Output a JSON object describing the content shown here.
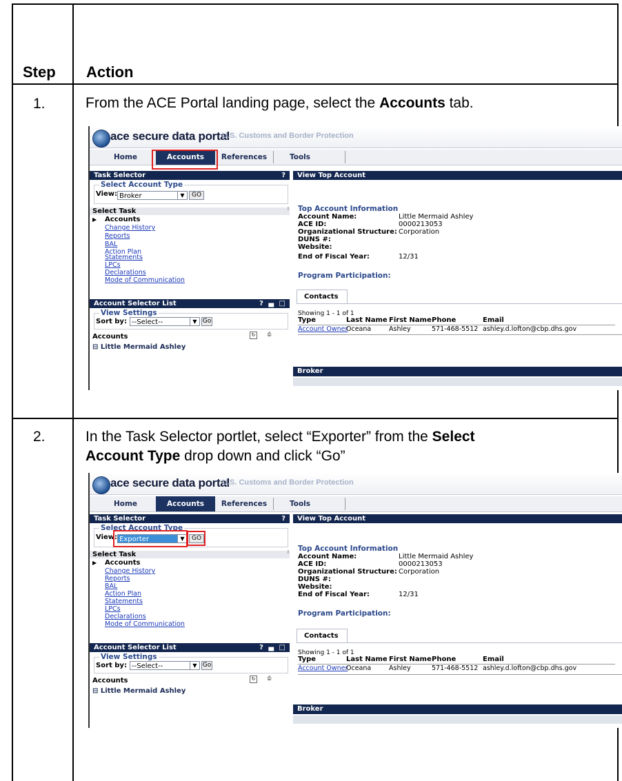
{
  "table": {
    "headers": {
      "step": "Step",
      "action": "Action"
    }
  },
  "steps": [
    {
      "number": "1.",
      "text_before": "From the ACE Portal landing page, select the ",
      "text_bold": "Accounts",
      "text_after": " tab."
    },
    {
      "number": "2.",
      "line1_before": "In the Task Selector portlet, select “Exporter” from the ",
      "line1_bold": "Select",
      "line2_bold": "Account Type",
      "line2_after": " drop down and click “Go”"
    }
  ],
  "portal": {
    "logo_text": "ace secure data portal",
    "logo_sub": "U.S. Customs and Border Protection",
    "tabs": [
      "Home",
      "Accounts",
      "References",
      "Tools"
    ],
    "task_selector": {
      "title": "Task Selector",
      "help": "?",
      "select_account_type": "Select Account Type",
      "view_label": "View:",
      "go": "GO",
      "select_task": "Select Task",
      "accounts": "Accounts",
      "links": [
        "Change History",
        "Reports",
        "BAL",
        "Action Plan",
        "Statements",
        "LPCs",
        "Declarations",
        "Mode of Communication"
      ]
    },
    "account_selector": {
      "title": "Account Selector List",
      "controls": "? ▄ □",
      "view_settings": "View Settings",
      "sort_by": "Sort by:",
      "sort_value": "--Select--",
      "go": "Go",
      "accounts": "Accounts",
      "tree_item": "⊟ Little Mermaid Ashley"
    },
    "view_top_account": {
      "title": "View Top Account",
      "info_header": "Top Account Information",
      "fields": [
        {
          "label": "Account Name:",
          "value": "Little Mermaid Ashley"
        },
        {
          "label": "ACE ID:",
          "value": "0000213053"
        },
        {
          "label": "Organizational Structure:",
          "value": "Corporation"
        },
        {
          "label": "DUNS #:",
          "value": ""
        },
        {
          "label": "Website:",
          "value": ""
        },
        {
          "label": "End of Fiscal Year:",
          "value": "12/31"
        }
      ],
      "program_participation": "Program Participation:",
      "contacts_tab": "Contacts",
      "showing": "Showing 1 - 1 of 1",
      "columns": [
        "Type",
        "Last Name",
        "First Name",
        "Phone",
        "Email"
      ],
      "row": [
        "Account Owner",
        "Oceana",
        "Ashley",
        "571-468-5512",
        "ashley.d.lofton@cbp.dhs.gov"
      ],
      "broker_bar": "Broker"
    },
    "screens": [
      {
        "view_value": "Broker"
      },
      {
        "view_value": "Exporter"
      }
    ]
  },
  "colors": {
    "portal_navy": "#13264f",
    "highlight_red": "#e02020",
    "link_blue": "#1a38b8",
    "dropdown_selected": "#3b8fd8"
  }
}
